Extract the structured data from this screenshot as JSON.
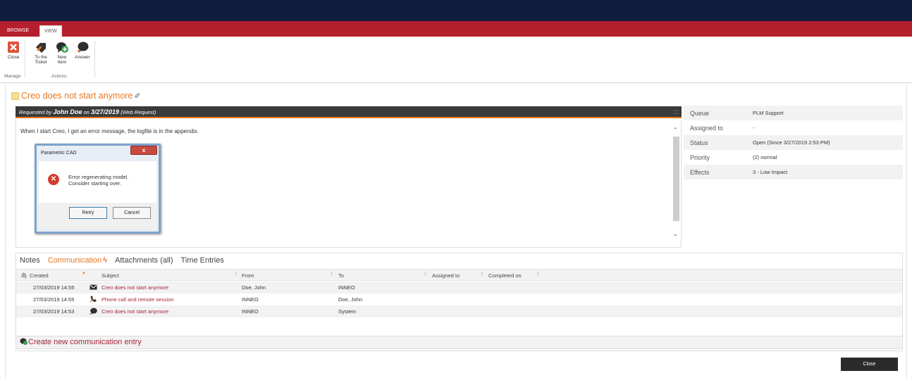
{
  "ribbon": {
    "tabs": [
      "BROWSE",
      "VIEW"
    ],
    "buttons": {
      "close": "Close",
      "to_ticket": "To the Ticket",
      "new_item": "New item",
      "answer": "Answer"
    },
    "groups": {
      "manage": "Manage",
      "actions": "Actions"
    }
  },
  "ticket": {
    "title": "Creo does not start anymore",
    "requested_by_label": "Requested by",
    "requester": "John Doe",
    "on_label": "on",
    "date": "3/27/2019",
    "source": "(Web Request)",
    "description": "When I start Creo, I get an error message, the logfile is in the appendix."
  },
  "dialog": {
    "title": "Parametric CAD",
    "close_glyph": "x",
    "message_line1": "Error regenerating model.",
    "message_line2": "Consider starting over.",
    "retry": "Retry",
    "cancel": "Cancel"
  },
  "properties": [
    {
      "label": "Queue",
      "value": "PLM Support"
    },
    {
      "label": "Assigned to",
      "value": "-"
    },
    {
      "label": "Status",
      "value": "Open (Since 3/27/2019 2:53 PM)"
    },
    {
      "label": "Priority",
      "value": "(2) normal"
    },
    {
      "label": "Effects",
      "value": "3 - Low Impact"
    }
  ],
  "tabs": [
    "Notes",
    "Communication",
    "Attachments (all)",
    "Time Entries"
  ],
  "grid": {
    "columns": [
      "Created",
      "Subject",
      "From",
      "To",
      "Assigned to",
      "Completed on"
    ],
    "rows": [
      {
        "created": "27/03/2019 14:55",
        "icon": "mail-icon",
        "subject": "Creo does not start anymore",
        "from": "Doe, John",
        "to": "INNEO"
      },
      {
        "created": "27/03/2019 14:55",
        "icon": "phone-icon",
        "subject": "Phone call and remote session",
        "from": "INNEO",
        "to": "Doe, John"
      },
      {
        "created": "27/03/2019 14:53",
        "icon": "speech-bubble-icon",
        "subject": "Creo does not start anymore",
        "from": "INNEO",
        "to": "System"
      }
    ]
  },
  "create_entry": "Create new communication entry",
  "footer": {
    "close": "Close"
  },
  "colors": {
    "navy": "#0e1e3c",
    "ribbon_red": "#b51f2e",
    "accent_orange": "#e87722",
    "link_red": "#a12638"
  }
}
